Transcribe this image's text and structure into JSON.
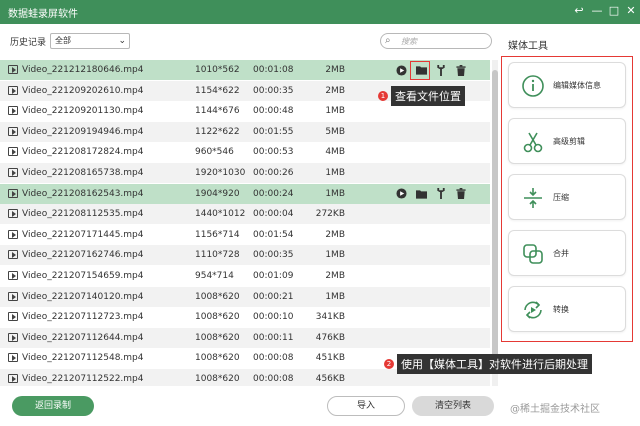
{
  "window": {
    "title": "数据蛙录屏软件",
    "controls": [
      "↩",
      "—",
      "□",
      "✕"
    ]
  },
  "filter": {
    "history_label": "历史记录",
    "select_value": "全部",
    "search_placeholder": "搜索"
  },
  "files": [
    {
      "name": "Video_221212180646.mp4",
      "resolution": "1010*562",
      "duration": "00:01:08",
      "size": "2MB",
      "selected": true,
      "show_actions": true
    },
    {
      "name": "Video_221209202610.mp4",
      "resolution": "1154*622",
      "duration": "00:00:35",
      "size": "2MB"
    },
    {
      "name": "Video_221209201130.mp4",
      "resolution": "1144*676",
      "duration": "00:00:48",
      "size": "1MB"
    },
    {
      "name": "Video_221209194946.mp4",
      "resolution": "1122*622",
      "duration": "00:01:55",
      "size": "5MB"
    },
    {
      "name": "Video_221208172824.mp4",
      "resolution": "960*546",
      "duration": "00:00:53",
      "size": "4MB"
    },
    {
      "name": "Video_221208165738.mp4",
      "resolution": "1920*1030",
      "duration": "00:00:26",
      "size": "1MB"
    },
    {
      "name": "Video_221208162543.mp4",
      "resolution": "1904*920",
      "duration": "00:00:24",
      "size": "1MB",
      "selected": true,
      "show_actions": true
    },
    {
      "name": "Video_221208112535.mp4",
      "resolution": "1440*1012",
      "duration": "00:00:04",
      "size": "272KB"
    },
    {
      "name": "Video_221207171445.mp4",
      "resolution": "1156*714",
      "duration": "00:01:54",
      "size": "2MB"
    },
    {
      "name": "Video_221207162746.mp4",
      "resolution": "1110*728",
      "duration": "00:00:35",
      "size": "1MB"
    },
    {
      "name": "Video_221207154659.mp4",
      "resolution": "954*714",
      "duration": "00:01:09",
      "size": "2MB"
    },
    {
      "name": "Video_221207140120.mp4",
      "resolution": "1008*620",
      "duration": "00:00:21",
      "size": "1MB"
    },
    {
      "name": "Video_221207112723.mp4",
      "resolution": "1008*620",
      "duration": "00:00:10",
      "size": "341KB"
    },
    {
      "name": "Video_221207112644.mp4",
      "resolution": "1008*620",
      "duration": "00:00:11",
      "size": "476KB"
    },
    {
      "name": "Video_221207112548.mp4",
      "resolution": "1008*620",
      "duration": "00:00:08",
      "size": "451KB"
    },
    {
      "name": "Video_221207112522.mp4",
      "resolution": "1008*620",
      "duration": "00:00:08",
      "size": "456KB"
    }
  ],
  "annotations": {
    "badge1": "1",
    "tip1": "查看文件位置",
    "badge2": "2",
    "tip2": "使用【媒体工具】对软件进行后期处理"
  },
  "tools": {
    "title": "媒体工具",
    "items": [
      {
        "label": "编辑媒体信息",
        "icon": "info-icon"
      },
      {
        "label": "高级剪辑",
        "icon": "scissors-icon"
      },
      {
        "label": "压缩",
        "icon": "compress-icon"
      },
      {
        "label": "合并",
        "icon": "merge-icon"
      },
      {
        "label": "转换",
        "icon": "convert-icon"
      }
    ]
  },
  "footer": {
    "back_label": "返回录制",
    "import_label": "导入",
    "clear_label": "清空列表",
    "watermark": "@稀土掘金技术社区"
  },
  "colors": {
    "brand_green": "#3f8f5a",
    "selected_row": "#bfe0c8",
    "annotation_red": "#e53935"
  }
}
